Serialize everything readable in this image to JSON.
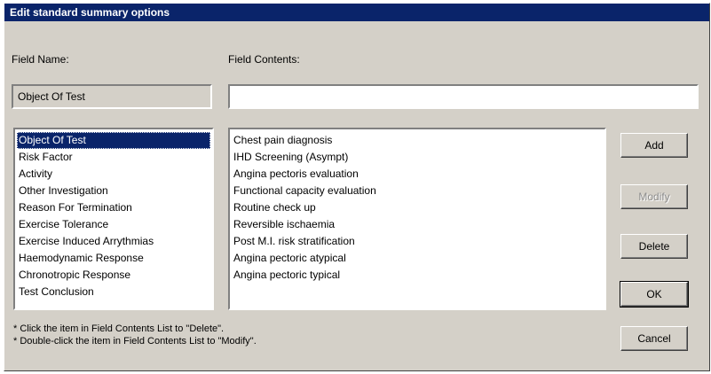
{
  "window": {
    "title": "Edit standard summary options"
  },
  "labels": {
    "field_name": "Field Name:",
    "field_contents": "Field Contents:"
  },
  "field_name_value": "Object Of Test",
  "field_contents_input": {
    "value": ""
  },
  "field_list": {
    "items": [
      "Object Of Test",
      "Risk Factor",
      "Activity",
      "Other Investigation",
      "Reason For Termination",
      "Exercise Tolerance",
      "Exercise Induced Arrythmias",
      "Haemodynamic Response",
      "Chronotropic Response",
      "Test Conclusion"
    ],
    "selected_index": 0
  },
  "contents_list": {
    "items": [
      "Chest pain diagnosis",
      "IHD Screening (Asympt)",
      "Angina pectoris evaluation",
      "Functional capacity evaluation",
      "Routine check up",
      "Reversible ischaemia",
      "Post M.I. risk stratification",
      "Angina pectoric atypical",
      "Angina pectoric typical"
    ]
  },
  "buttons": {
    "add": "Add",
    "modify": "Modify",
    "delete": "Delete",
    "ok": "OK",
    "cancel": "Cancel"
  },
  "hints": {
    "delete_hint": "* Click the item in Field Contents List to \"Delete\".",
    "modify_hint": "* Double-click the item in Field Contents List to \"Modify\"."
  }
}
